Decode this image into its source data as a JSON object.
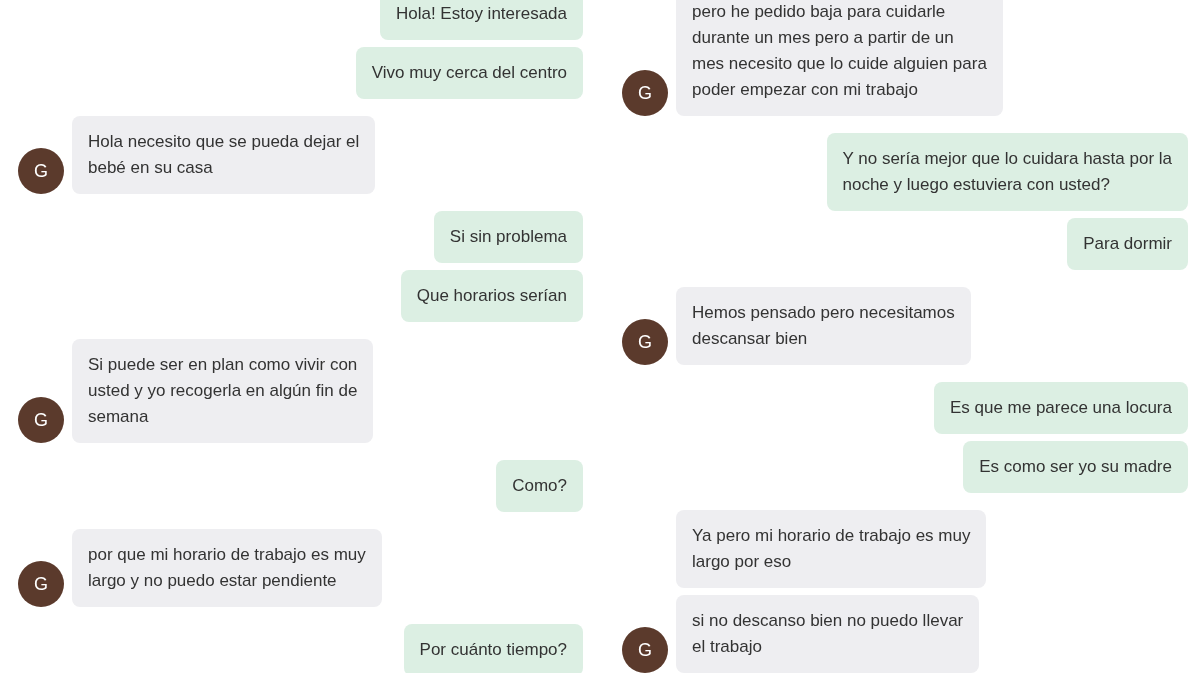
{
  "columns": [
    {
      "messages": [
        {
          "kind": "sent",
          "text": "Hola! Estoy interesada"
        },
        {
          "kind": "sent",
          "text": "Vivo muy cerca del centro"
        },
        {
          "kind": "received",
          "avatar": "G",
          "text": "Hola necesito que se pueda dejar el\nbebé en su casa"
        },
        {
          "kind": "sent",
          "text": "Si sin problema"
        },
        {
          "kind": "sent",
          "text": "Que horarios serían"
        },
        {
          "kind": "received",
          "avatar": "G",
          "text": "Si puede ser en plan como vivir con\nusted y yo recogerla en algún fin de\nsemana"
        },
        {
          "kind": "sent",
          "text": "Como?"
        },
        {
          "kind": "received",
          "avatar": "G",
          "text": "por que mi horario de trabajo es muy\nlargo y no puedo estar pendiente"
        },
        {
          "kind": "sent",
          "text": "Por cuánto tiempo?"
        }
      ]
    },
    {
      "messages": [
        {
          "kind": "received",
          "avatar": "G",
          "text": "pero he pedido baja para cuidarle\ndurante un mes pero a partir de un\nmes necesito que lo cuide alguien para\npoder empezar con mi trabajo"
        },
        {
          "kind": "sent",
          "text": "Y no sería mejor que lo cuidara hasta por la\nnoche y luego estuviera con usted?"
        },
        {
          "kind": "sent",
          "text": "Para dormir"
        },
        {
          "kind": "received",
          "avatar": "G",
          "text": "Hemos pensado pero necesitamos\ndescansar bien"
        },
        {
          "kind": "sent",
          "text": "Es que me parece una locura"
        },
        {
          "kind": "sent",
          "text": "Es como ser yo su madre"
        },
        {
          "kind": "received",
          "text": "Ya pero mi horario de trabajo es muy\nlargo por eso"
        },
        {
          "kind": "received",
          "avatar": "G",
          "text": "si no descanso bien no puedo llevar\nel trabajo"
        }
      ]
    }
  ]
}
